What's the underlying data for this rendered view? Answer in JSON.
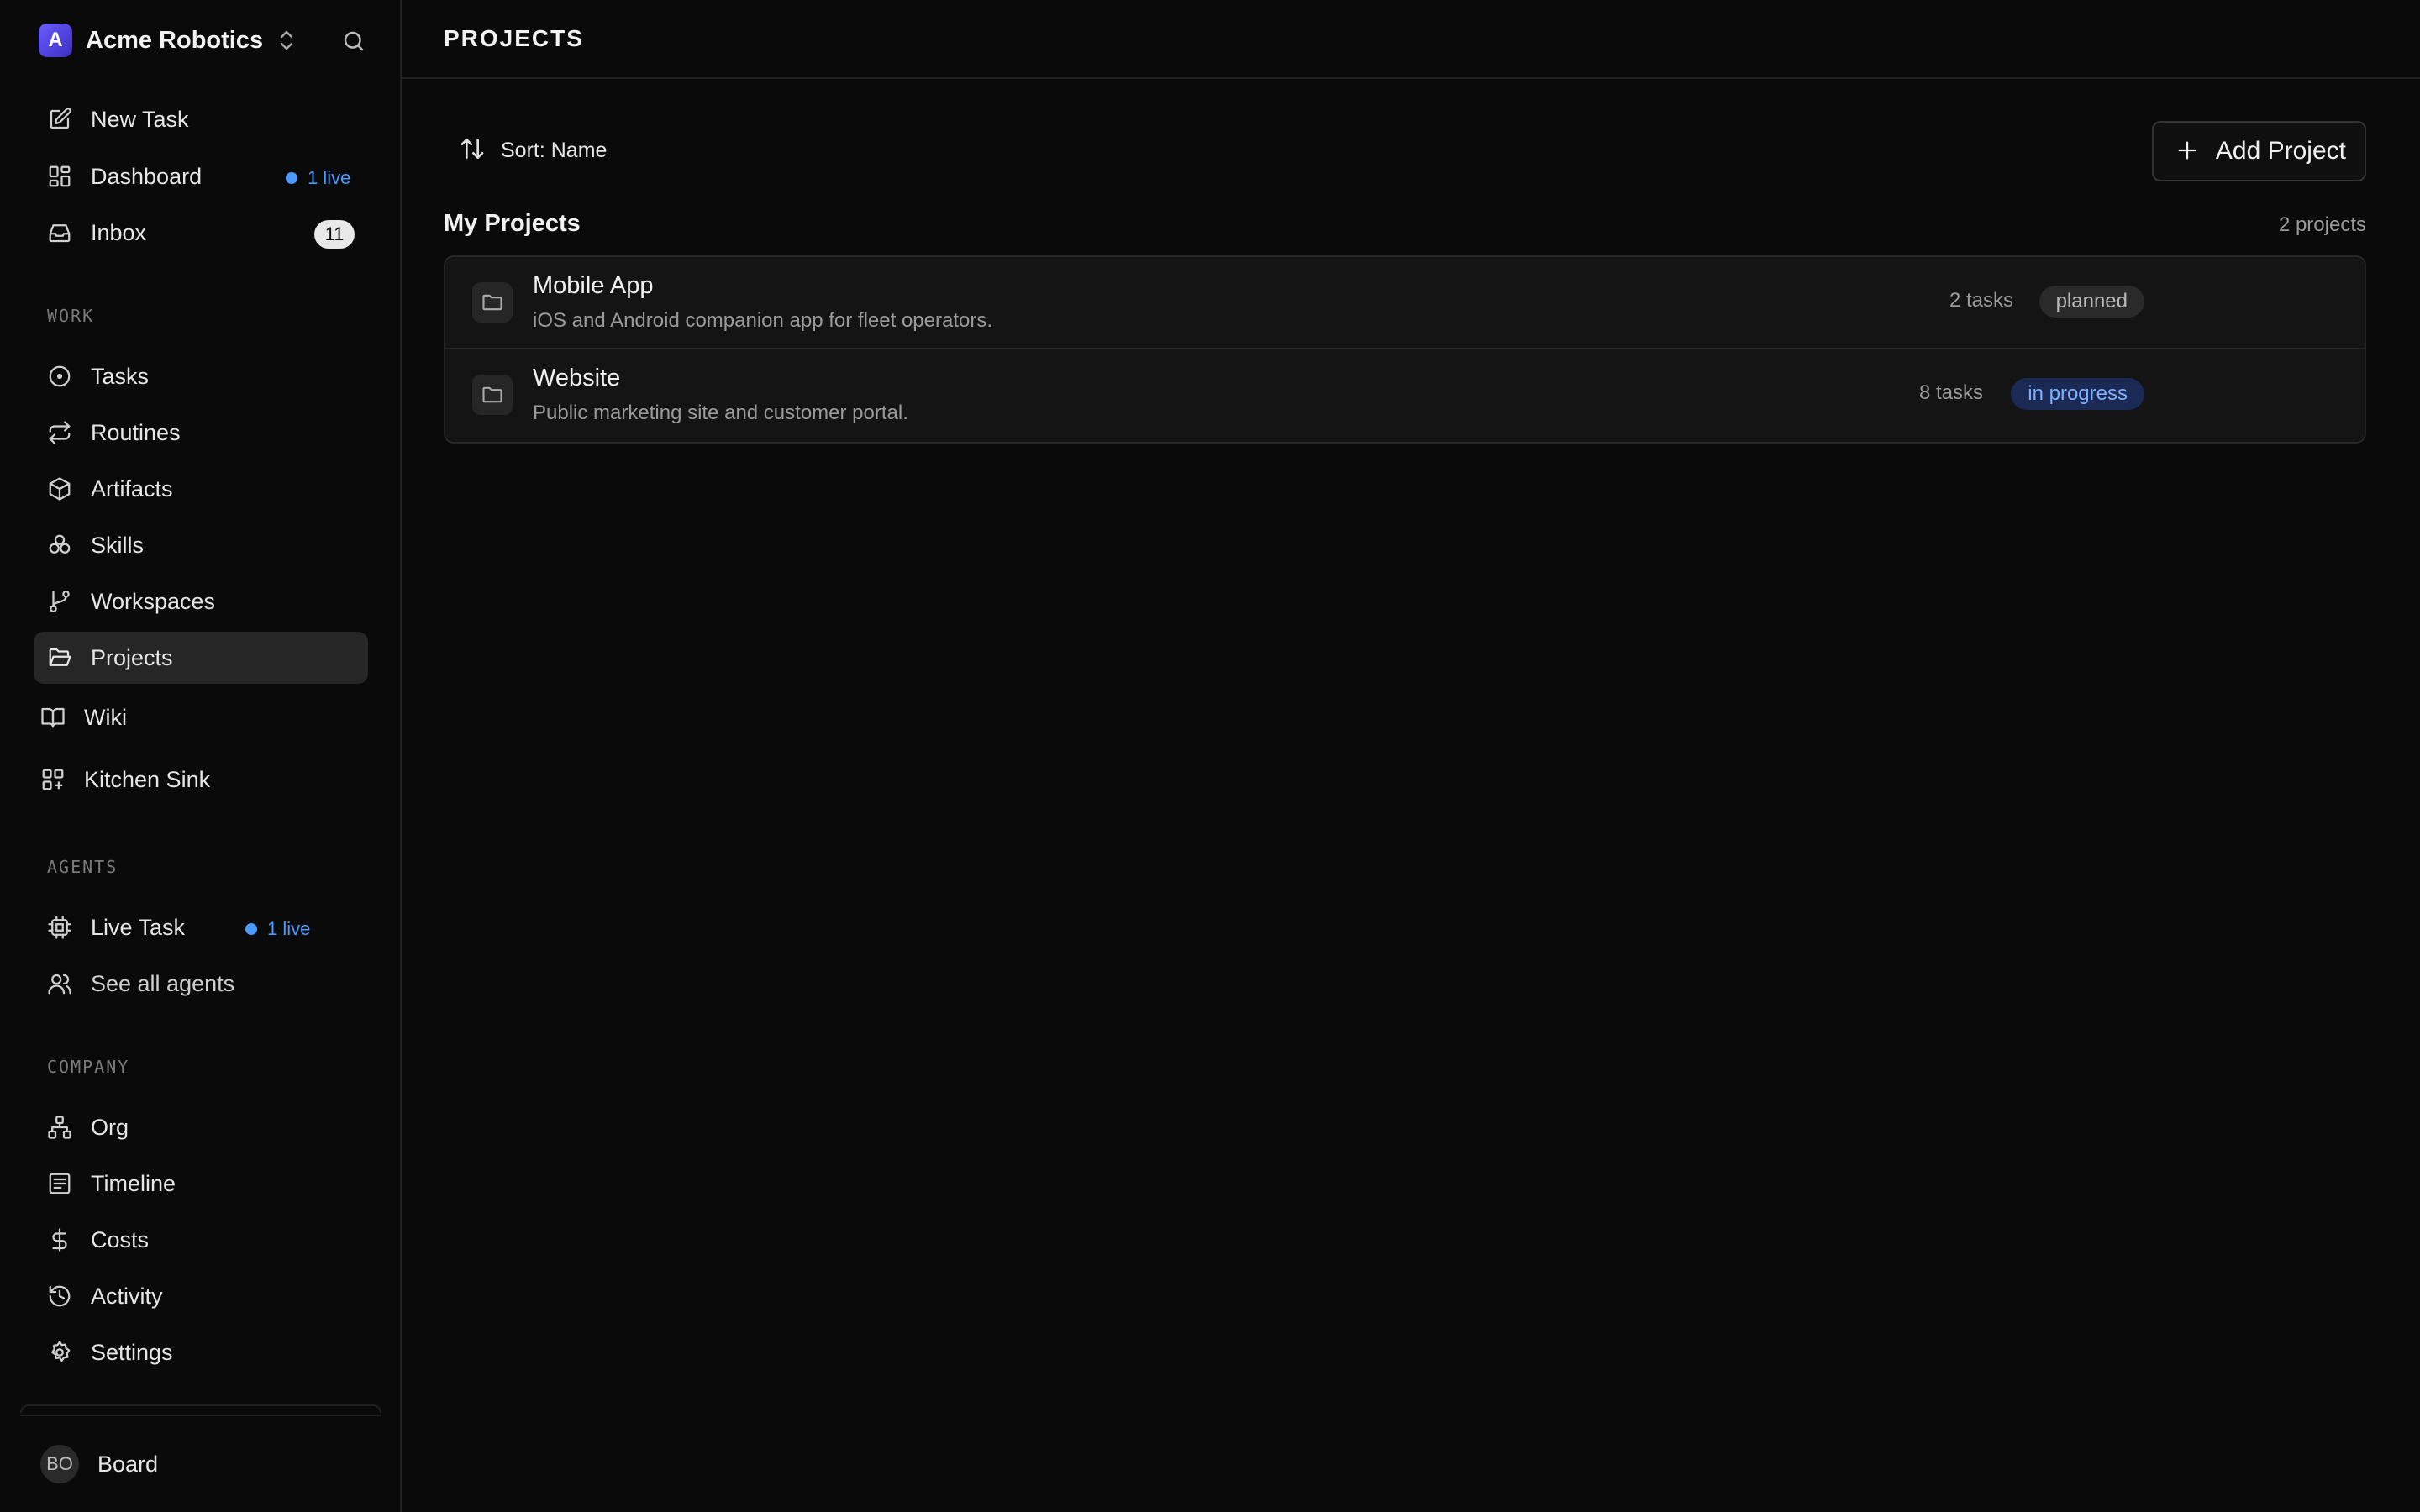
{
  "brand": {
    "initial": "A",
    "name": "Acme Robotics"
  },
  "sidebar": {
    "top_items": [
      {
        "label": "New Task"
      },
      {
        "label": "Dashboard",
        "badge": "1 live"
      },
      {
        "label": "Inbox",
        "count": "11"
      }
    ],
    "sections": {
      "work": "WORK",
      "agents": "AGENTS",
      "company": "COMPANY"
    },
    "work_items": [
      {
        "label": "Tasks"
      },
      {
        "label": "Routines"
      },
      {
        "label": "Artifacts"
      },
      {
        "label": "Skills"
      },
      {
        "label": "Workspaces"
      },
      {
        "label": "Projects",
        "active": true
      },
      {
        "label": "Wiki"
      },
      {
        "label": "Kitchen Sink"
      }
    ],
    "agent_items": [
      {
        "label": "Live Task",
        "badge": "1 live"
      },
      {
        "label": "See all agents"
      }
    ],
    "company_items": [
      {
        "label": "Org"
      },
      {
        "label": "Timeline"
      },
      {
        "label": "Costs"
      },
      {
        "label": "Activity"
      },
      {
        "label": "Settings"
      }
    ],
    "user": {
      "initials": "BO",
      "name": "Board"
    }
  },
  "header": {
    "title": "PROJECTS"
  },
  "toolbar": {
    "sort_label": "Sort: Name",
    "add_label": "Add Project"
  },
  "group": {
    "title": "My Projects",
    "count": "2 projects",
    "projects": [
      {
        "name": "Mobile App",
        "description": "iOS and Android companion app for fleet operators.",
        "tasks": "2 tasks",
        "status": "planned"
      },
      {
        "name": "Website",
        "description": "Public marketing site and customer portal.",
        "tasks": "8 tasks",
        "status": "in progress"
      }
    ]
  },
  "colors": {
    "accent_live": "#4a9bff",
    "status_planned_bg": "#2a2a2a",
    "status_progress_bg": "#1a2a55",
    "status_progress_text": "#7fb0ff"
  }
}
